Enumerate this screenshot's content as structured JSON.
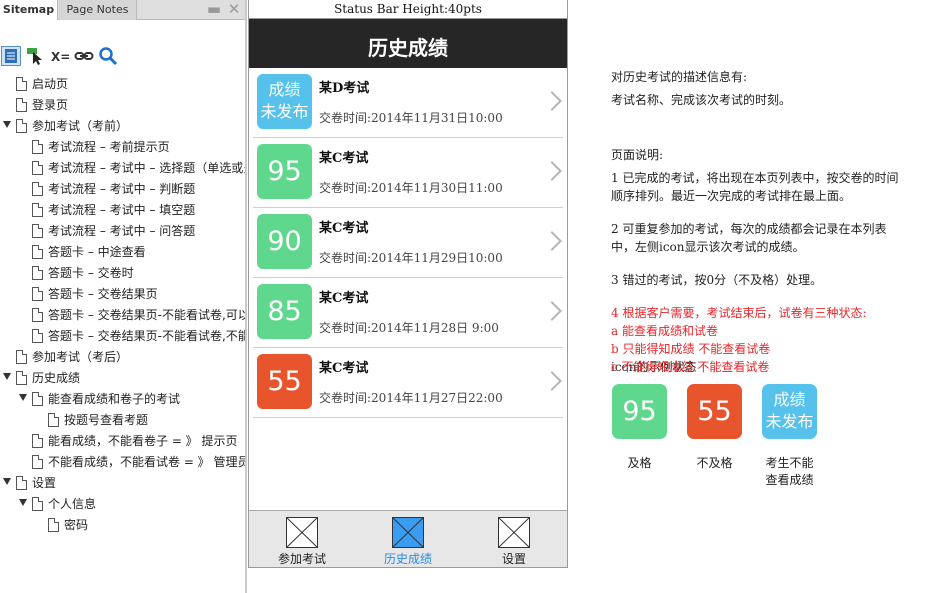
{
  "sitemap_panel": {
    "tabs": [
      "Sitemap",
      "Page Notes"
    ],
    "window_buttons": [
      "▬",
      "✕"
    ],
    "tree": [
      {
        "label": "启动页",
        "level": 1,
        "expander": false
      },
      {
        "label": "登录页",
        "level": 1,
        "expander": false
      },
      {
        "label": "参加考试（考前）",
        "level": 0,
        "expander": true
      },
      {
        "label": "考试流程 – 考前提示页",
        "level": 2,
        "expander": false
      },
      {
        "label": "考试流程 – 考试中 – 选择题（单选或多",
        "level": 2,
        "expander": false
      },
      {
        "label": "考试流程 – 考试中 – 判断题",
        "level": 2,
        "expander": false
      },
      {
        "label": "考试流程 – 考试中 – 填空题",
        "level": 2,
        "expander": false
      },
      {
        "label": "考试流程 – 考试中 – 问答题",
        "level": 2,
        "expander": false
      },
      {
        "label": "答题卡 – 中途查看",
        "level": 2,
        "expander": false
      },
      {
        "label": "答题卡 – 交卷时",
        "level": 2,
        "expander": false
      },
      {
        "label": "答题卡 – 交卷结果页",
        "level": 2,
        "expander": false
      },
      {
        "label": "答题卡 – 交卷结果页-不能看试卷,可以",
        "level": 2,
        "expander": false
      },
      {
        "label": "答题卡 – 交卷结果页-不能看试卷,不能",
        "level": 2,
        "expander": false
      },
      {
        "label": "参加考试（考后）",
        "level": 1,
        "expander": false
      },
      {
        "label": "历史成绩",
        "level": 0,
        "expander": true
      },
      {
        "label": "能查看成绩和卷子的考试",
        "level": 1,
        "expander": true
      },
      {
        "label": "按题号查看考题",
        "level": 3,
        "expander": false
      },
      {
        "label": "能看成绩，不能看卷子 = 》 提示页",
        "level": 2,
        "expander": false
      },
      {
        "label": "不能看成绩，不能看试卷 = 》 管理员自",
        "level": 2,
        "expander": false
      },
      {
        "label": "设置",
        "level": 0,
        "expander": true
      },
      {
        "label": "个人信息",
        "level": 1,
        "expander": true
      },
      {
        "label": "密码",
        "level": 3,
        "expander": false
      }
    ]
  },
  "phone": {
    "status_bar": "Status Bar Height:40pts",
    "nav_title": "历史成绩",
    "rows": [
      {
        "badge": [
          "成绩",
          "未发布"
        ],
        "color": "#56c1ea",
        "title": "某D考试",
        "time": "交卷时间:2014年11月31日10:00"
      },
      {
        "badge": [
          "95"
        ],
        "color": "#5fd88d",
        "title": "某C考试",
        "time": "交卷时间:2014年11月30日11:00"
      },
      {
        "badge": [
          "90"
        ],
        "color": "#5fd88d",
        "title": "某C考试",
        "time": "交卷时间:2014年11月29日10:00"
      },
      {
        "badge": [
          "85"
        ],
        "color": "#5fd88d",
        "title": "某C考试",
        "time": "交卷时间:2014年11月28日 9:00"
      },
      {
        "badge": [
          "55"
        ],
        "color": "#e8542b",
        "title": "某C考试",
        "time": "交卷时间:2014年11月27日22:00"
      }
    ],
    "tab_bar": [
      {
        "label": "参加考试",
        "active": false
      },
      {
        "label": "历史成绩",
        "active": true
      },
      {
        "label": "设置",
        "active": false
      }
    ],
    "active_color": "#2b8ce8",
    "active_icon_fill": "#3a9cf0"
  },
  "notes": {
    "desc_title": "对历史考试的描述信息有:",
    "desc_body": "考试名称、完成该次考试的时刻。",
    "page_title": "页面说明:",
    "p1_line1": "1 已完成的考试，将出现在本页列表中，按交卷的时间",
    "p1_line2": "顺序排列。最近一次完成的考试排在最上面。",
    "p2_line1": "2 可重复参加的考试，每次的成绩都会记录在本列表",
    "p2_line2": "中，左侧icon显示该次考试的成绩。",
    "p3": "3 错过的考试，按0分（不及格）处理。",
    "p4_title": "4 根据客户需要，考试结束后，试卷有三种状态:",
    "p4_a": "a 能查看成绩和试卷",
    "p4_b": "b 只能得知成绩 不能查看试卷",
    "p4_c_overlap": "icon的示例状态",
    "p4_c": "c 不能得知成绩 不能查看试卷",
    "legend": [
      {
        "badge": [
          "95"
        ],
        "color": "#5fd88d",
        "label": [
          "及格"
        ]
      },
      {
        "badge": [
          "55"
        ],
        "color": "#e8542b",
        "label": [
          "不及格"
        ]
      },
      {
        "badge": [
          "成绩",
          "未发布"
        ],
        "color": "#56c1ea",
        "label": [
          "考生不能",
          "查看成绩"
        ]
      }
    ]
  }
}
